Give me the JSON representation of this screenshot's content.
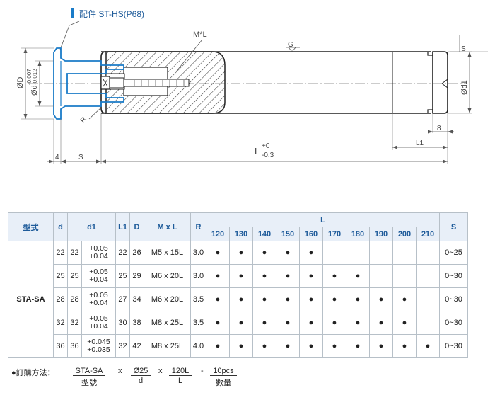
{
  "part_label": "配件 ST-HS(P68)",
  "drawing": {
    "label_mxl": "M*L",
    "label_g": "G",
    "label_d": "ØD",
    "label_d_tol": "Ød",
    "label_d_tol_upper": "-0.007",
    "label_d_tol_lower": "-0.012",
    "label_d1": "Ød1",
    "label_r": "R",
    "label_4": "4",
    "label_s": "S",
    "label_l": "L",
    "label_l_upper": "+0",
    "label_l_lower": "-0.3",
    "label_l1": "L1",
    "label_8": "8",
    "label_s_right": "S"
  },
  "table": {
    "headers": {
      "model": "型式",
      "d": "d",
      "d1": "d1",
      "l1": "L1",
      "D": "D",
      "mxl": "M x L",
      "r": "R",
      "l": "L",
      "s": "S"
    },
    "l_values": [
      "120",
      "130",
      "140",
      "150",
      "160",
      "170",
      "180",
      "190",
      "200",
      "210"
    ],
    "model": "STA-SA",
    "rows": [
      {
        "d": "22",
        "d1": "22",
        "tol_up": "+0.05",
        "tol_low": "+0.04",
        "l1": "22",
        "D": "26",
        "mxl": "M5 x 15L",
        "r": "3.0",
        "avail": [
          1,
          1,
          1,
          1,
          1,
          0,
          0,
          0,
          0,
          0
        ],
        "s": "0~25"
      },
      {
        "d": "25",
        "d1": "25",
        "tol_up": "+0.05",
        "tol_low": "+0.04",
        "l1": "25",
        "D": "29",
        "mxl": "M6 x 20L",
        "r": "3.0",
        "avail": [
          1,
          1,
          1,
          1,
          1,
          1,
          1,
          0,
          0,
          0
        ],
        "s": "0~30"
      },
      {
        "d": "28",
        "d1": "28",
        "tol_up": "+0.05",
        "tol_low": "+0.04",
        "l1": "27",
        "D": "34",
        "mxl": "M6 x 20L",
        "r": "3.5",
        "avail": [
          1,
          1,
          1,
          1,
          1,
          1,
          1,
          1,
          1,
          0
        ],
        "s": "0~30"
      },
      {
        "d": "32",
        "d1": "32",
        "tol_up": "+0.05",
        "tol_low": "+0.04",
        "l1": "30",
        "D": "38",
        "mxl": "M8 x 25L",
        "r": "3.5",
        "avail": [
          1,
          1,
          1,
          1,
          1,
          1,
          1,
          1,
          1,
          0
        ],
        "s": "0~30"
      },
      {
        "d": "36",
        "d1": "36",
        "tol_up": "+0.045",
        "tol_low": "+0.035",
        "l1": "32",
        "D": "42",
        "mxl": "M8 x 25L",
        "r": "4.0",
        "avail": [
          1,
          1,
          1,
          1,
          1,
          1,
          1,
          1,
          1,
          1
        ],
        "s": "0~30"
      }
    ],
    "dot": "●"
  },
  "order": {
    "label": "●訂購方法：",
    "parts": [
      {
        "value": "STA-SA",
        "caption": "型號"
      },
      {
        "value": "Ø25",
        "caption": "d"
      },
      {
        "value": "120L",
        "caption": "L"
      },
      {
        "value": "10pcs",
        "caption": "數量"
      }
    ],
    "sep1": "x",
    "sep2": "x",
    "sep3": "-"
  },
  "colors": {
    "accent": "#1e5b9a",
    "part_blue": "#1a7bc8",
    "header_bg": "#e8eff8",
    "line": "#333333"
  }
}
